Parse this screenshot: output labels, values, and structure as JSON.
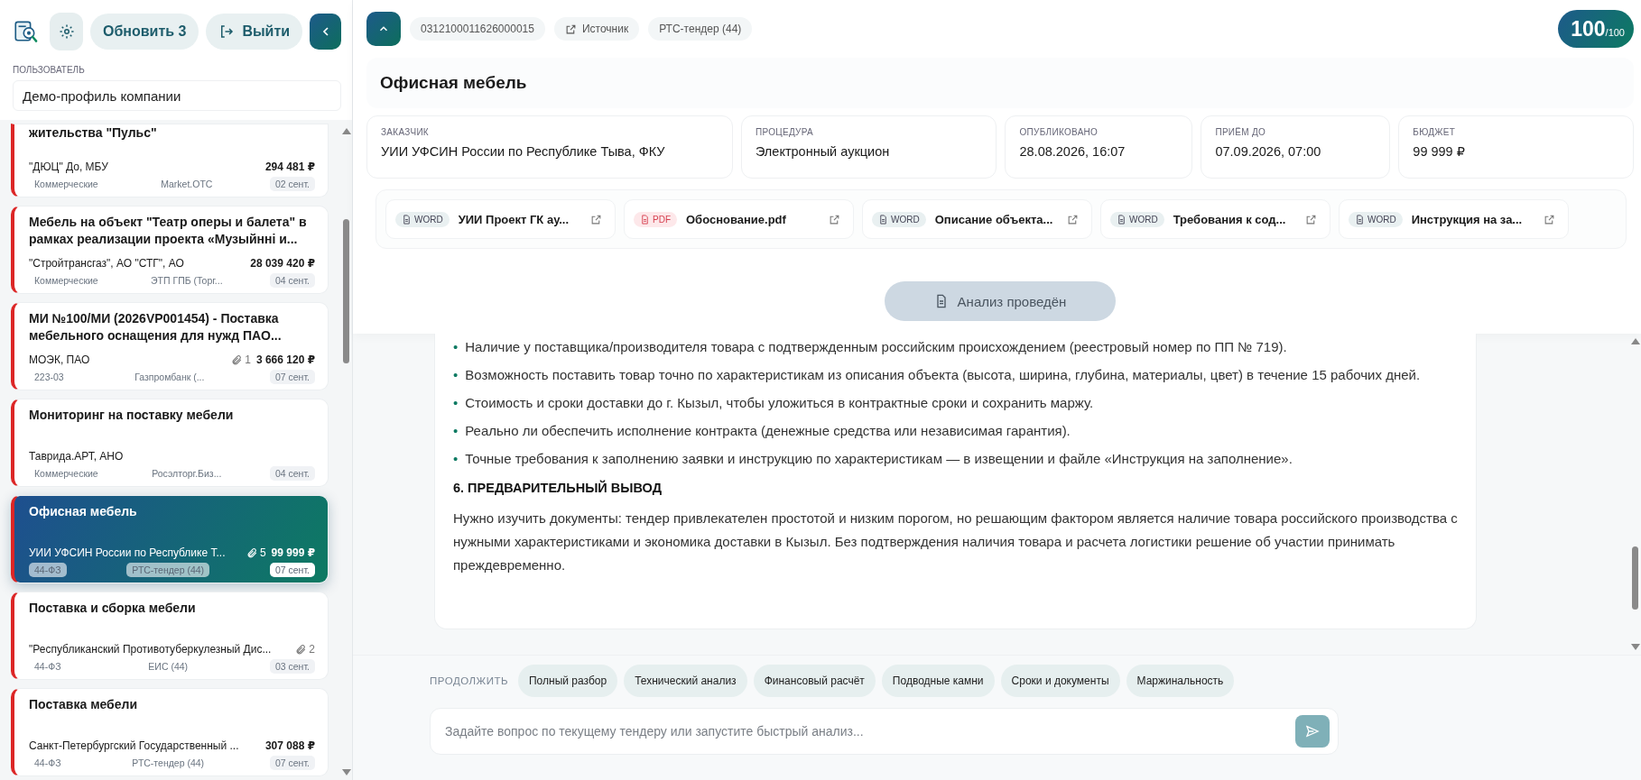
{
  "sidebar": {
    "buttons": [
      {
        "kind": "settings"
      },
      {
        "kind": "refresh",
        "label": "Обновить 3"
      },
      {
        "kind": "logout",
        "label": "Выйти"
      },
      {
        "kind": "collapse"
      }
    ],
    "user_label": "ПОЛЬЗОВАТЕЛЬ",
    "user_value": "Демо-профиль компании"
  },
  "tenders": [
    {
      "title": "жительства \"Пульс\"",
      "customer": "\"ДЮЦ\" До, МБУ",
      "price": "294 481 ₽",
      "law": "Коммерческие",
      "platform": "Market.OTC",
      "date": "02 сент.",
      "selected": false
    },
    {
      "title": "Мебель на объект \"Театр оперы и балета\" в рамках реализации проекта «Музыйнні и...",
      "customer": "\"Стройтрансгаз\", АО \"СТГ\", АО",
      "price": "28 039 420 ₽",
      "law": "Коммерческие",
      "platform": "ЭТП ГПБ (Торг...",
      "date": "04 сент.",
      "selected": false
    },
    {
      "title": "МИ №100/МИ (2026VP001454) - Поставка мебельного оснащения для нужд ПАО...",
      "customer": "МОЭК, ПАО",
      "attachments": "1",
      "price": "3 666 120 ₽",
      "law": "223-03",
      "platform": "Газпромбанк (...",
      "date": "07 сент.",
      "selected": false
    },
    {
      "title": "Мониторинг на поставку мебели",
      "customer": "Таврида.АРТ, АНО",
      "law": "Коммерческие",
      "platform": "Росэлторг.Биз...",
      "date": "04 сент.",
      "selected": false
    },
    {
      "title": "Офисная мебель",
      "customer": "УИИ УФСИН России по Республике Т...",
      "attachments": "5",
      "price": "99 999 ₽",
      "law": "44-ФЗ",
      "platform": "РТС-тендер (44)",
      "date": "07 сент.",
      "selected": true
    },
    {
      "title": "Поставка и сборка мебели",
      "customer": "\"Республиканский Противотуберкулезный Дис...",
      "attachments": "2",
      "law": "44-ФЗ",
      "platform": "ЕИС (44)",
      "date": "03 сент.",
      "selected": false
    },
    {
      "title": "Поставка мебели",
      "customer": "Санкт-Петербургский Государственный ...",
      "price": "307 088 ₽",
      "law": "44-ФЗ",
      "platform": "РТС-тендер (44)",
      "date": "07 сент.",
      "selected": false
    }
  ],
  "top_bar": {
    "number": "0312100011626000015",
    "source_link": "Источник",
    "platform": "РТС-тендер (44)",
    "score": "100",
    "score_max": "/100"
  },
  "title": "Офисная мебель",
  "info": [
    {
      "label": "ЗАКАЗЧИК",
      "value": "УИИ УФСИН России по Республике Тыва, ФКУ"
    },
    {
      "label": "ПРОЦЕДУРА",
      "value": "Электронный аукцион"
    },
    {
      "label": "ОПУБЛИКОВАНО",
      "value": "28.08.2026, 16:07"
    },
    {
      "label": "ПРИЁМ ДО",
      "value": "07.09.2026, 07:00"
    },
    {
      "label": "БЮДЖЕТ",
      "value": "99 999 ₽"
    }
  ],
  "documents": [
    {
      "type": "WORD",
      "name": "УИИ Проект ГК ау..."
    },
    {
      "type": "PDF",
      "name": "Обоснование.pdf"
    },
    {
      "type": "WORD",
      "name": "Описание объекта..."
    },
    {
      "type": "WORD",
      "name": "Требования к сод..."
    },
    {
      "type": "WORD",
      "name": "Инструкция на за..."
    }
  ],
  "analysis_button": {
    "label": "Анализ проведён",
    "disabled": true
  },
  "report": {
    "marker": "•",
    "bullets": [
      "Наличие у поставщика/производителя товара с подтвержденным российским происхождением (реестровый номер по ПП № 719).",
      "Возможность поставить товар точно по характеристикам из описания объекта (высота, ширина, глубина, материалы, цвет) в течение 15 рабочих дней.",
      "Стоимость и сроки доставки до г. Кызыл, чтобы уложиться в контрактные сроки и сохранить маржу.",
      "Реально ли обеспечить исполнение контракта (денежные средства или независимая гарантия).",
      "Точные требования к заполнению заявки и инструкцию по характеристикам — в извещении и файле «Инструкция на заполнение»."
    ],
    "heading": "6. ПРЕДВАРИТЕЛЬНЫЙ ВЫВОД",
    "paragraph": "Нужно изучить документы: тендер привлекателен простотой и низким порогом, но решающим фактором является наличие товара российского производства с нужными характеристиками и экономика доставки в Кызыл. Без подтверждения наличия товара и расчета логистики решение об участии принимать преждевременно."
  },
  "continue_label": "ПРОДОЛЖИТЬ",
  "quick_actions": [
    "Полный разбор",
    "Технический анализ",
    "Финансовый расчёт",
    "Подводные камни",
    "Сроки и документы",
    "Маржинальность"
  ],
  "chat": {
    "placeholder": "Задайте вопрос по текущему тендеру или запустите быстрый анализ..."
  }
}
